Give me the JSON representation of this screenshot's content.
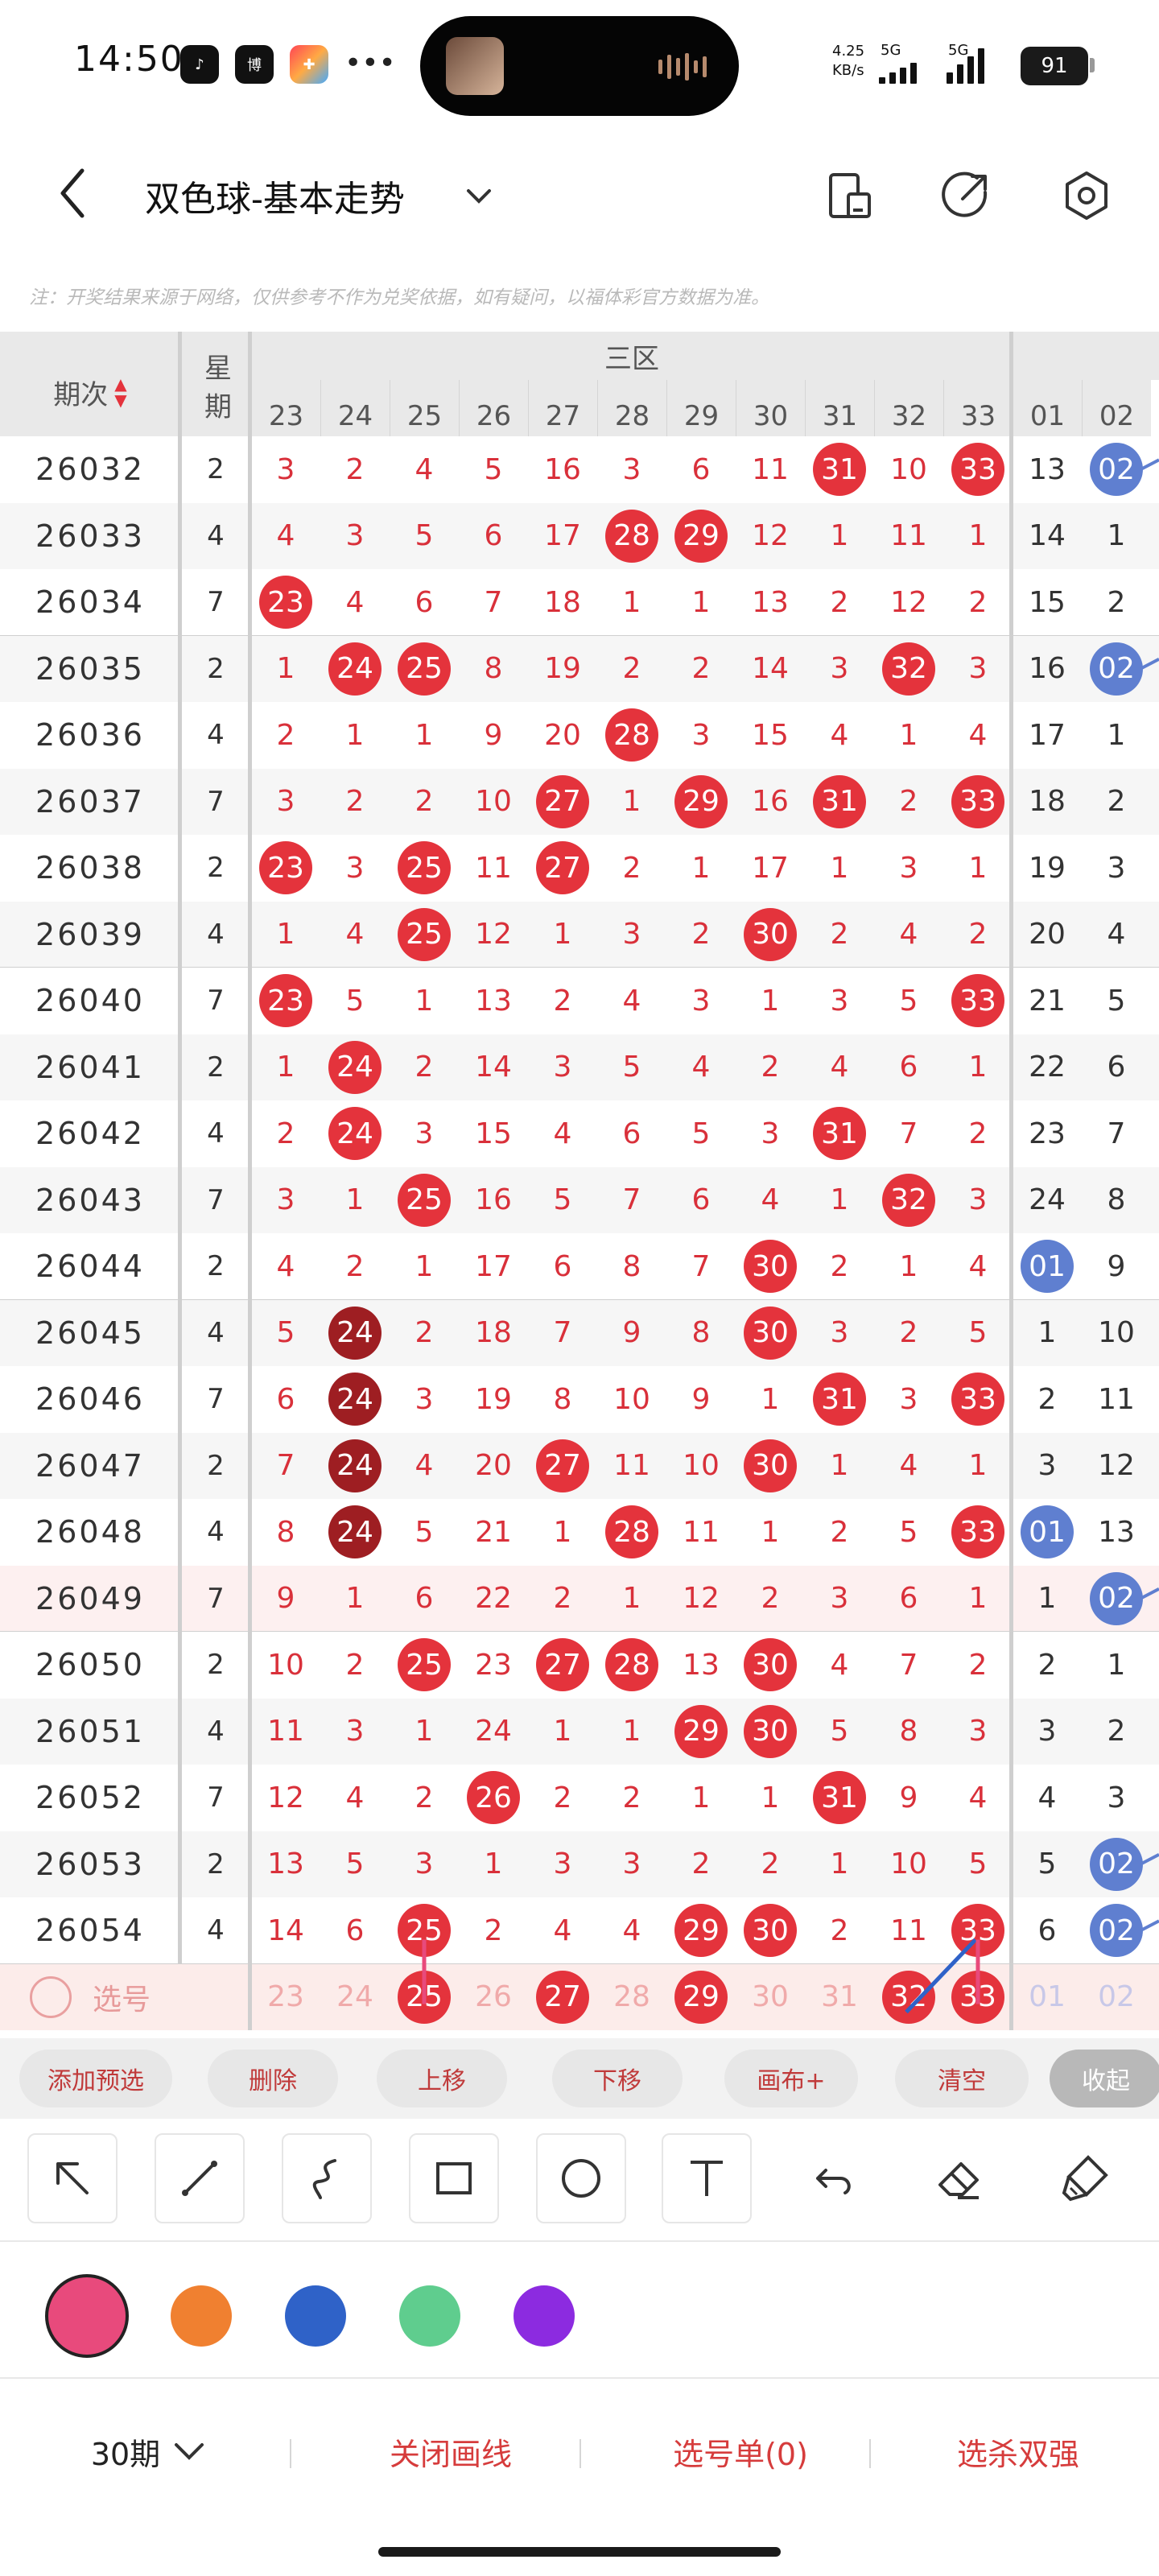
{
  "status": {
    "time": "14:50",
    "apps": [
      "tiktok-icon",
      "news-icon",
      "game-icon"
    ],
    "app_label_2": "博",
    "dots": "•••",
    "net_speed_value": "4.25",
    "net_speed_unit": "KB/s",
    "sig1_label": "5G",
    "sig2_label": "5G",
    "battery": "91"
  },
  "header": {
    "title": "双色球-基本走势"
  },
  "notice": "注：开奖结果来源于网络，仅供参考不作为兑奖依据，如有疑问，以福体彩官方数据为准。",
  "table": {
    "issue_header": "期次",
    "count_header": "星期",
    "zone_header": "三区",
    "red_columns": [
      "23",
      "24",
      "25",
      "26",
      "27",
      "28",
      "29",
      "30",
      "31",
      "32",
      "33"
    ],
    "blue_columns": [
      "01",
      "02"
    ],
    "rows": [
      {
        "issue": "26032",
        "n": "2",
        "red": [
          "3",
          "2",
          "4",
          "5",
          "16",
          "3",
          "6",
          "11",
          "#31",
          "10",
          "#33"
        ],
        "blue": [
          "13",
          "@02"
        ]
      },
      {
        "issue": "26033",
        "n": "4",
        "red": [
          "4",
          "3",
          "5",
          "6",
          "17",
          "#28",
          "#29",
          "12",
          "1",
          "11",
          "1"
        ],
        "blue": [
          "14",
          "1"
        ]
      },
      {
        "issue": "26034",
        "n": "7",
        "red": [
          "#23",
          "4",
          "6",
          "7",
          "18",
          "1",
          "1",
          "13",
          "2",
          "12",
          "2"
        ],
        "blue": [
          "15",
          "2"
        ]
      },
      {
        "issue": "26035",
        "n": "2",
        "red": [
          "1",
          "#24",
          "#25",
          "8",
          "19",
          "2",
          "2",
          "14",
          "3",
          "#32",
          "3"
        ],
        "blue": [
          "16",
          "@02"
        ]
      },
      {
        "issue": "26036",
        "n": "4",
        "red": [
          "2",
          "1",
          "1",
          "9",
          "20",
          "#28",
          "3",
          "15",
          "4",
          "1",
          "4"
        ],
        "blue": [
          "17",
          "1"
        ]
      },
      {
        "issue": "26037",
        "n": "7",
        "red": [
          "3",
          "2",
          "2",
          "10",
          "#27",
          "1",
          "#29",
          "16",
          "#31",
          "2",
          "#33"
        ],
        "blue": [
          "18",
          "2"
        ]
      },
      {
        "issue": "26038",
        "n": "2",
        "red": [
          "#23",
          "3",
          "#25",
          "11",
          "#27",
          "2",
          "1",
          "17",
          "1",
          "3",
          "1"
        ],
        "blue": [
          "19",
          "3"
        ]
      },
      {
        "issue": "26039",
        "n": "4",
        "red": [
          "1",
          "4",
          "#25",
          "12",
          "1",
          "3",
          "2",
          "#30",
          "2",
          "4",
          "2"
        ],
        "blue": [
          "20",
          "4"
        ]
      },
      {
        "issue": "26040",
        "n": "7",
        "red": [
          "#23",
          "5",
          "1",
          "13",
          "2",
          "4",
          "3",
          "1",
          "3",
          "5",
          "#33"
        ],
        "blue": [
          "21",
          "5"
        ]
      },
      {
        "issue": "26041",
        "n": "2",
        "red": [
          "1",
          "#24",
          "2",
          "14",
          "3",
          "5",
          "4",
          "2",
          "4",
          "6",
          "1"
        ],
        "blue": [
          "22",
          "6"
        ]
      },
      {
        "issue": "26042",
        "n": "4",
        "red": [
          "2",
          "#24",
          "3",
          "15",
          "4",
          "6",
          "5",
          "3",
          "#31",
          "7",
          "2"
        ],
        "blue": [
          "23",
          "7"
        ]
      },
      {
        "issue": "26043",
        "n": "7",
        "red": [
          "3",
          "1",
          "#25",
          "16",
          "5",
          "7",
          "6",
          "4",
          "1",
          "#32",
          "3"
        ],
        "blue": [
          "24",
          "8"
        ]
      },
      {
        "issue": "26044",
        "n": "2",
        "red": [
          "4",
          "2",
          "1",
          "17",
          "6",
          "8",
          "7",
          "#30",
          "2",
          "1",
          "4"
        ],
        "blue": [
          "@01",
          "9"
        ]
      },
      {
        "issue": "26045",
        "n": "4",
        "red": [
          "5",
          "$24",
          "2",
          "18",
          "7",
          "9",
          "8",
          "#30",
          "3",
          "2",
          "5"
        ],
        "blue": [
          "1",
          "10"
        ]
      },
      {
        "issue": "26046",
        "n": "7",
        "red": [
          "6",
          "$24",
          "3",
          "19",
          "8",
          "10",
          "9",
          "1",
          "#31",
          "3",
          "#33"
        ],
        "blue": [
          "2",
          "11"
        ]
      },
      {
        "issue": "26047",
        "n": "2",
        "red": [
          "7",
          "$24",
          "4",
          "20",
          "#27",
          "11",
          "10",
          "#30",
          "1",
          "4",
          "1"
        ],
        "blue": [
          "3",
          "12"
        ]
      },
      {
        "issue": "26048",
        "n": "4",
        "red": [
          "8",
          "$24",
          "5",
          "21",
          "1",
          "#28",
          "11",
          "1",
          "2",
          "5",
          "#33"
        ],
        "blue": [
          "@01",
          "13"
        ]
      },
      {
        "issue": "26049",
        "n": "7",
        "red": [
          "9",
          "1",
          "6",
          "22",
          "2",
          "1",
          "12",
          "2",
          "3",
          "6",
          "1"
        ],
        "blue": [
          "1",
          "@02"
        ]
      },
      {
        "issue": "26050",
        "n": "2",
        "red": [
          "10",
          "2",
          "#25",
          "23",
          "#27",
          "#28",
          "13",
          "#30",
          "4",
          "7",
          "2"
        ],
        "blue": [
          "2",
          "1"
        ]
      },
      {
        "issue": "26051",
        "n": "4",
        "red": [
          "11",
          "3",
          "1",
          "24",
          "1",
          "1",
          "#29",
          "#30",
          "5",
          "8",
          "3"
        ],
        "blue": [
          "3",
          "2"
        ]
      },
      {
        "issue": "26052",
        "n": "7",
        "red": [
          "12",
          "4",
          "2",
          "#26",
          "2",
          "2",
          "1",
          "1",
          "#31",
          "9",
          "4"
        ],
        "blue": [
          "4",
          "3"
        ]
      },
      {
        "issue": "26053",
        "n": "2",
        "red": [
          "13",
          "5",
          "3",
          "1",
          "3",
          "3",
          "2",
          "2",
          "1",
          "10",
          "5"
        ],
        "blue": [
          "5",
          "@02"
        ]
      },
      {
        "issue": "26054",
        "n": "4",
        "red": [
          "14",
          "6",
          "#25",
          "2",
          "4",
          "4",
          "#29",
          "#30",
          "2",
          "11",
          "#33"
        ],
        "blue": [
          "6",
          "@02"
        ]
      }
    ],
    "select_label": "选号",
    "select_row": [
      "23",
      "24",
      "#25",
      "26",
      "#27",
      "28",
      "#29",
      "30",
      "31",
      "#32",
      "#33"
    ],
    "select_blue": [
      "01",
      "02"
    ]
  },
  "actions": [
    "添加预选",
    "删除",
    "上移",
    "下移",
    "画布+",
    "清空",
    "收起"
  ],
  "tools": [
    "arrow-tool-icon",
    "line-tool-icon",
    "curve-tool-icon",
    "rect-tool-icon",
    "circle-tool-icon",
    "text-tool-icon",
    "undo-icon",
    "eraser-icon",
    "clear-icon"
  ],
  "colors": [
    "#e84a7c",
    "#f08030",
    "#2f62c8",
    "#5fcd8e",
    "#8c2be0"
  ],
  "bottom": {
    "periods": "30期",
    "close_lines": "关闭画线",
    "pick_list": "选号单(0)",
    "pick_strong": "选杀双强"
  }
}
